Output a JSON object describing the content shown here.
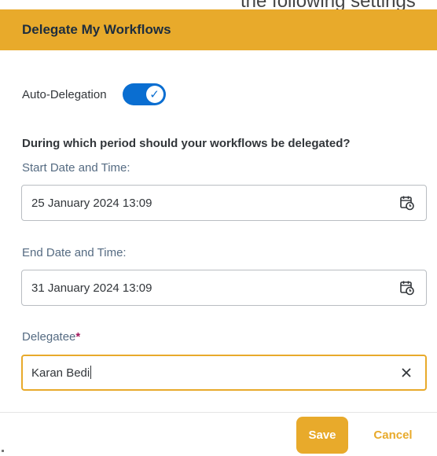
{
  "top_strip_text": "the following settings",
  "dialog": {
    "title": "Delegate My Workflows"
  },
  "auto_delegation": {
    "label": "Auto-Delegation",
    "enabled": true
  },
  "question": "During which period should your workflows be delegated?",
  "start": {
    "label": "Start Date and Time:",
    "value": "25 January 2024 13:09",
    "icon": "calendar-clock-icon"
  },
  "end": {
    "label": "End Date and Time:",
    "value": "31 January 2024 13:09",
    "icon": "calendar-clock-icon"
  },
  "delegatee": {
    "label": "Delegatee",
    "required_mark": "*",
    "value": "Karan Bedi",
    "clear_icon": "close-icon"
  },
  "footer": {
    "save_label": "Save",
    "cancel_label": "Cancel"
  },
  "colors": {
    "accent": "#e8aa2b",
    "toggle": "#0a6ed1",
    "required": "#a2195e"
  }
}
